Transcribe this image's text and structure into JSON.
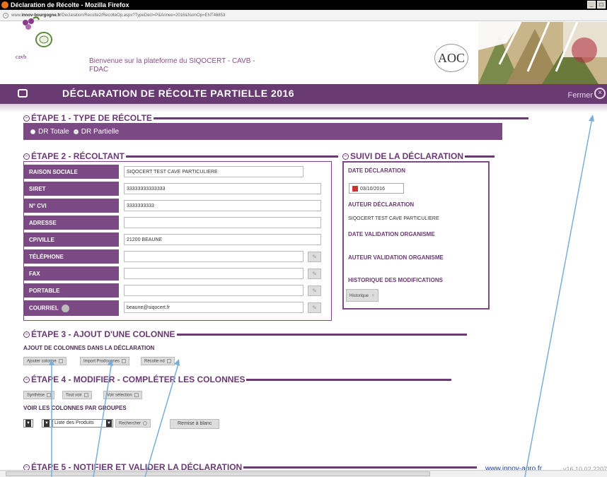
{
  "window": {
    "title": "Déclaration de Récolte - Mozilla Firefox",
    "url_prefix": "www.",
    "url_domain": "innov-bourgogne.fr",
    "url_rest": "/Declaration/Recolte2/RecolteOp.aspx?TypeDecl=P&Annee=2016&NumOp=ENT46853"
  },
  "header": {
    "welcome": "Bienvenue sur la plateforme du SIQOCERT - CAVB - FDAC",
    "logo_cavb": "cavb",
    "logo_aoc": "AOC"
  },
  "banner": {
    "title": "DÉCLARATION DE RÉCOLTE PARTIELLE 2016",
    "close_label": "Fermer"
  },
  "step1": {
    "title": "ÉTAPE 1 - TYPE DE RÉCOLTE",
    "option_total": "DR Totale",
    "option_partial": "DR Partielle"
  },
  "step2": {
    "title": "ÉTAPE 2 - RÉCOLTANT",
    "rows": [
      {
        "label": "RAISON SOCIALE",
        "value": "SIQOCERT TEST CAVE PARTICULIERE"
      },
      {
        "label": "SIRET",
        "value": "33333333333333"
      },
      {
        "label": "N° CVI",
        "value": "3333333333"
      },
      {
        "label": "ADRESSE",
        "value": ""
      },
      {
        "label": "CP/VILLE",
        "value": "21200 BEAUNE"
      },
      {
        "label": "TÉLÉPHONE",
        "value": ""
      },
      {
        "label": "FAX",
        "value": ""
      },
      {
        "label": "PORTABLE",
        "value": ""
      },
      {
        "label": "COURRIEL",
        "value": "beaune@siqocert.fr"
      }
    ]
  },
  "suivi": {
    "title": "SUIVI DE LA DÉCLARATION",
    "date_label": "DATE DÉCLARATION",
    "date_value": "03/10/2016",
    "author_label": "AUTEUR DÉCLARATION",
    "author_value": "SIQOCERT TEST CAVE PARTICULIERE",
    "validation_date_label": "DATE VALIDATION ORGANISME",
    "validation_author_label": "AUTEUR VALIDATION ORGANISME",
    "history_label": "HISTORIQUE DES MODIFICATIONS",
    "history_button": "Historique"
  },
  "step3": {
    "title": "ÉTAPE 3 - AJOUT D'UNE COLONNE",
    "subtitle": "AJOUT DE COLONNES DANS LA DÉCLARATION",
    "btn_add": "Ajouter colonne",
    "btn_import": "Import Prodouanes",
    "btn_recolte": "Récolte nd"
  },
  "step4": {
    "title": "ÉTAPE 4 - MODIFIER - COMPLÉTER LES COLONNES",
    "btn_synthese": "Synthèse",
    "btn_tout": "Tout voir",
    "btn_voir": "Voir sélection",
    "groups_label": "VOIR LES COLONNES PAR GROUPES",
    "select_products": "Liste des Produits",
    "btn_search": "Rechercher",
    "btn_reset": "Remise à blanc"
  },
  "step5": {
    "title": "ÉTAPE 5 - NOTIFIER ET VALIDER LA DÉCLARATION"
  },
  "footer": {
    "link": "www.innov-agro.fr",
    "version": "v16.10.02.2207"
  },
  "colors": {
    "purple": "#6a3a73",
    "arrow": "#7aaed8"
  }
}
